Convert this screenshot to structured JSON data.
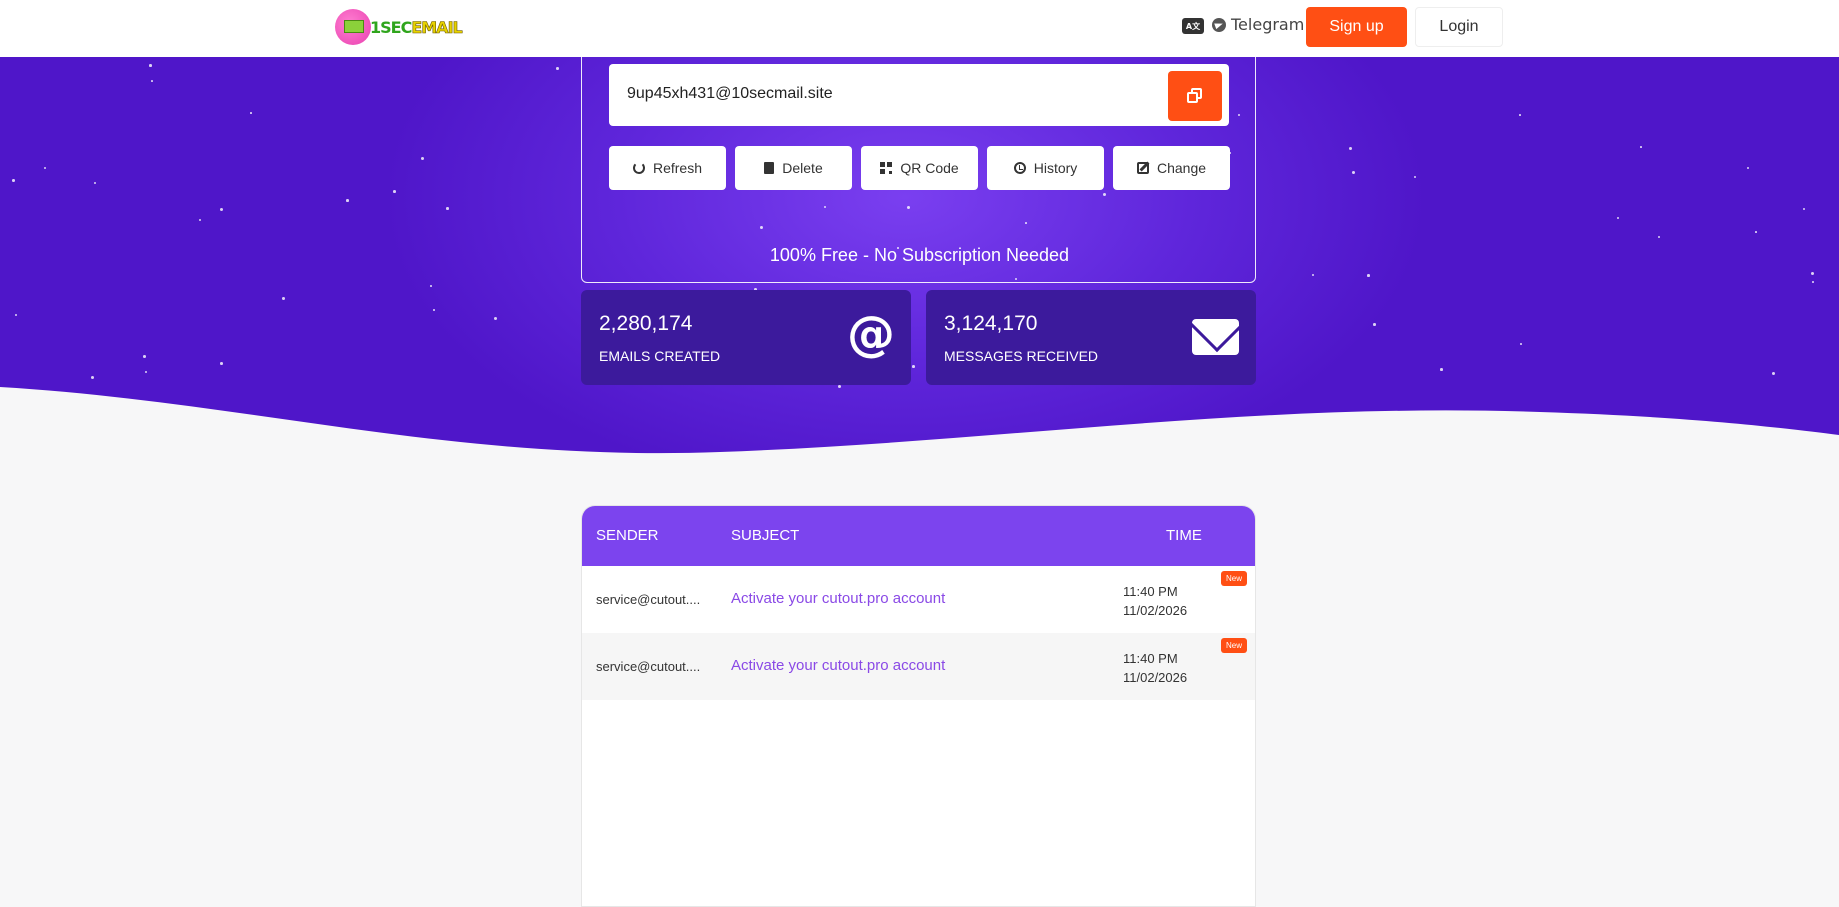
{
  "header": {
    "logo_part1": "1SEC",
    "logo_part2": "EMAIL",
    "lang_icon": "translate-icon",
    "telegram_label": "Telegram",
    "signup_label": "Sign up",
    "login_label": "Login"
  },
  "email": {
    "address": "9up45xh431@10secmail.site",
    "copy_icon": "copy-icon"
  },
  "actions": [
    {
      "label": "Refresh",
      "icon": "refresh-icon"
    },
    {
      "label": "Delete",
      "icon": "trash-icon"
    },
    {
      "label": "QR Code",
      "icon": "qr-code-icon"
    },
    {
      "label": "History",
      "icon": "history-icon"
    },
    {
      "label": "Change",
      "icon": "edit-icon"
    }
  ],
  "tagline": "100% Free - No Subscription Needed",
  "stats": [
    {
      "value": "2,280,174",
      "label": "EMAILS CREATED",
      "icon": "at-icon",
      "icon_glyph": "@"
    },
    {
      "value": "3,124,170",
      "label": "MESSAGES RECEIVED",
      "icon": "envelope-icon"
    }
  ],
  "inbox": {
    "columns": [
      "SENDER",
      "SUBJECT",
      "TIME"
    ],
    "rows": [
      {
        "sender": "service@cutout....",
        "subject": "Activate your cutout.pro account",
        "time_line1": "11:40 PM",
        "time_line2": "11/02/2026",
        "badge": "New"
      },
      {
        "sender": "service@cutout....",
        "subject": "Activate your cutout.pro account",
        "time_line1": "11:40 PM",
        "time_line2": "11/02/2026",
        "badge": "New"
      }
    ]
  },
  "colors": {
    "accent_orange": "#ff4f14",
    "hero_purple": "#5f26db",
    "stat_purple": "#3c1a9c",
    "table_header": "#7c44ee",
    "subject_link": "#8a49e6"
  }
}
